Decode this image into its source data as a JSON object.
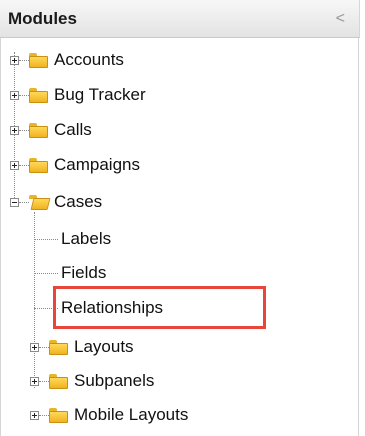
{
  "header": {
    "title": "Modules",
    "collapse_glyph": "<"
  },
  "tree": {
    "modules": [
      {
        "label": "Accounts",
        "expanded": false,
        "icon": "folder-closed-icon"
      },
      {
        "label": "Bug Tracker",
        "expanded": false,
        "icon": "folder-closed-icon"
      },
      {
        "label": "Calls",
        "expanded": false,
        "icon": "folder-closed-icon"
      },
      {
        "label": "Campaigns",
        "expanded": false,
        "icon": "folder-closed-icon"
      },
      {
        "label": "Cases",
        "expanded": true,
        "icon": "folder-open-icon"
      }
    ],
    "cases_children": [
      {
        "label": "Labels",
        "type": "leaf"
      },
      {
        "label": "Fields",
        "type": "leaf"
      },
      {
        "label": "Relationships",
        "type": "leaf",
        "highlighted": true
      },
      {
        "label": "Layouts",
        "type": "folder",
        "expanded": false
      },
      {
        "label": "Subpanels",
        "type": "folder",
        "expanded": false
      },
      {
        "label": "Mobile Layouts",
        "type": "folder",
        "expanded": false
      }
    ]
  },
  "colors": {
    "highlight_border": "#e8463b",
    "folder_fill": "#f5c53a",
    "tree_line": "#8a8a8a"
  }
}
